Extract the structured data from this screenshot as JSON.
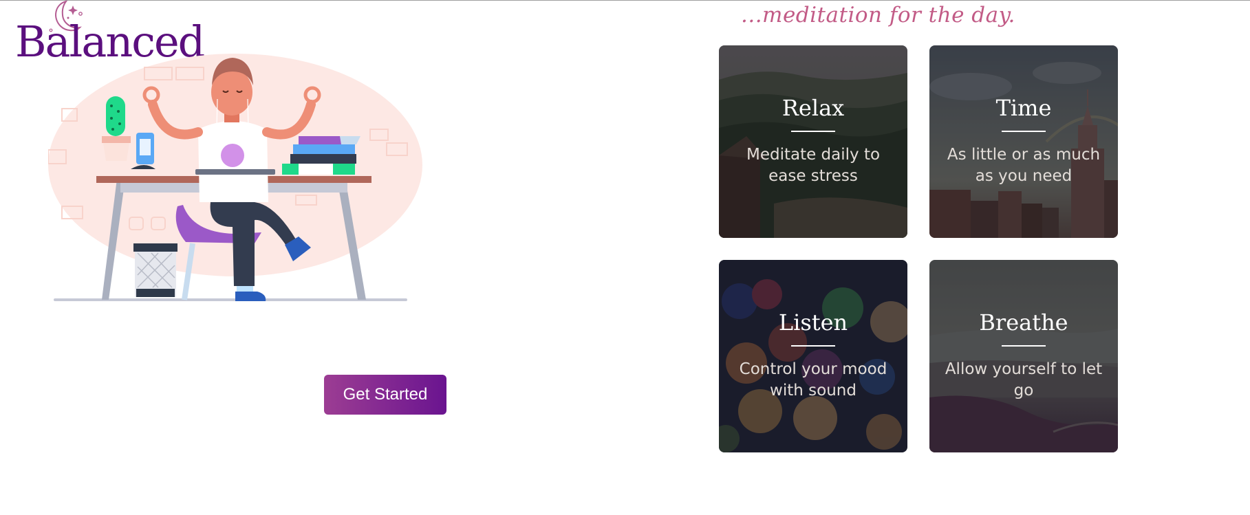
{
  "brand": {
    "name": "Balanced",
    "icon": "crescent-moon-icon",
    "color": "#5b0f7e"
  },
  "hero": {
    "illustration": "meditating-person-at-desk",
    "cta_label": "Get Started"
  },
  "tagline": "...meditation for the day.",
  "cards": [
    {
      "title": "Relax",
      "description": "Meditate daily to ease stress",
      "image": "forest-hills"
    },
    {
      "title": "Time",
      "description": "As little or as much as you need",
      "image": "city-skyline"
    },
    {
      "title": "Listen",
      "description": "Control your mood with sound",
      "image": "bokeh-lights"
    },
    {
      "title": "Breathe",
      "description": "Allow yourself to let go",
      "image": "coastline"
    }
  ],
  "colors": {
    "accent": "#c25b86",
    "button_start": "#9c3d93",
    "button_end": "#6a1490"
  }
}
